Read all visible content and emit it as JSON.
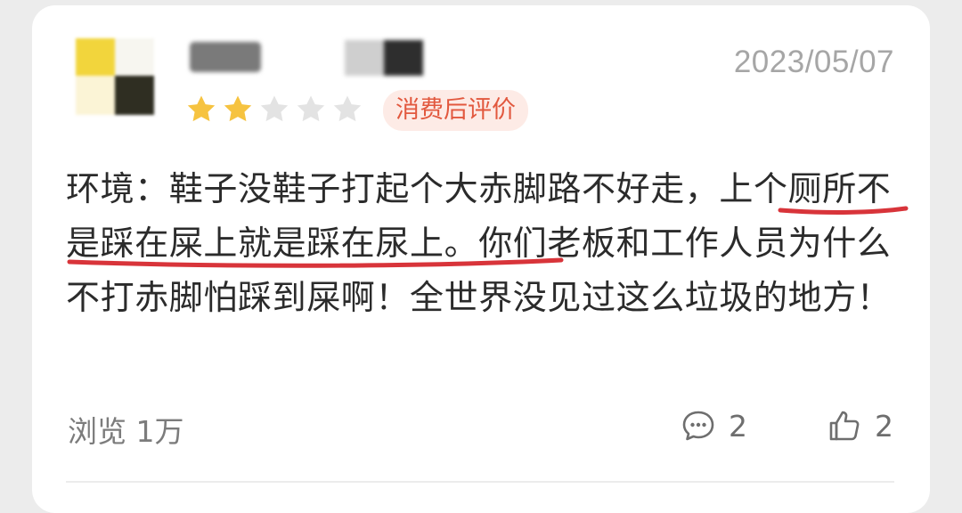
{
  "review": {
    "date": "2023/05/07",
    "rating": 2,
    "rating_max": 5,
    "badge": "消费后评价",
    "text_before": "环境：鞋子没鞋子打起个大赤脚路不好走，",
    "text_highlight": "上个厕所不是踩在屎上就是踩在尿上",
    "text_after": "。你们老板和工作人员为什么不打赤脚怕踩到屎啊！全世界没见过这么垃圾的地方！",
    "views": "浏览 1万",
    "comments": "2",
    "likes": "2"
  },
  "colors": {
    "star_filled": "#f6c340",
    "star_empty": "#e3e3e3",
    "badge_text": "#e2583e",
    "badge_bg": "#fdebe6",
    "underline": "#d8343a"
  },
  "icons": {
    "comment": "comment-bubble-icon",
    "like": "thumbs-up-icon"
  }
}
